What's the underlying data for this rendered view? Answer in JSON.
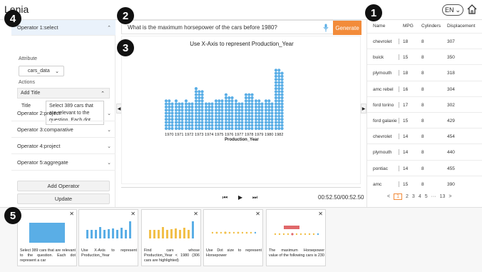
{
  "app": {
    "title": "Lenia"
  },
  "topbar": {
    "language": "EN",
    "home_icon": "home-icon"
  },
  "left_panel": {
    "operators": [
      {
        "label": "Operator 1:select"
      },
      {
        "label": "Operator 2:project"
      },
      {
        "label": "Operator 3:comparative"
      },
      {
        "label": "Operator 4:project"
      },
      {
        "label": "Operator 5:aggregate"
      }
    ],
    "attribute_label": "Attribute",
    "attribute_value": "cars_data",
    "actions_label": "Actions",
    "add_title_label": "Add Title",
    "title_label": "Title",
    "title_text": "Select 389 cars that are relevant to the question. Each dot represent a car",
    "add_operator_label": "Add Operator",
    "update_label": "Update"
  },
  "question": {
    "text": "What is the maximum horsepower of the cars before 1980?",
    "generate_label": "Generate"
  },
  "chart_data": {
    "type": "bar",
    "title": "Use X-Axis to represent Production_Year",
    "xlabel": "Production_Year",
    "ylabel": "",
    "categories": [
      "1970",
      "1971",
      "1972",
      "1973",
      "1974",
      "1975",
      "1976",
      "1977",
      "1978",
      "1979",
      "1980",
      "1982"
    ],
    "values": [
      29,
      28,
      28,
      40,
      27,
      30,
      34,
      28,
      36,
      29,
      29,
      59
    ],
    "color": "#5aaee6"
  },
  "player": {
    "time": "00:52.50/00:52.50"
  },
  "table": {
    "headers": [
      "Name",
      "MPG",
      "Cylinders",
      "Displacement"
    ],
    "rows": [
      [
        "chevrolet",
        "18",
        "8",
        "307"
      ],
      [
        "buick",
        "15",
        "8",
        "350"
      ],
      [
        "plymouth",
        "18",
        "8",
        "318"
      ],
      [
        "amc rebel",
        "16",
        "8",
        "304"
      ],
      [
        "ford torino",
        "17",
        "8",
        "302"
      ],
      [
        "ford galaxie",
        "15",
        "8",
        "429"
      ],
      [
        "chevrolet",
        "14",
        "8",
        "454"
      ],
      [
        "plymouth",
        "14",
        "8",
        "440"
      ],
      [
        "pontiac",
        "14",
        "8",
        "455"
      ],
      [
        "amc",
        "15",
        "8",
        "390"
      ]
    ],
    "pages": [
      "1",
      "2",
      "3",
      "4",
      "5",
      "···",
      "13"
    ],
    "prev": "<",
    "next": ">"
  },
  "cards": [
    {
      "text": "Select 389 cars that are relevant to the question. Each dot represent a car"
    },
    {
      "text": "Use X-Axis to represent Production_Year"
    },
    {
      "text": "Find cars whose Production_Year < 1980 (306 cars are highlighted)"
    },
    {
      "text": "Use Dot size to represent Horsepower"
    },
    {
      "text": "The maximum Horsepower value of the following cars is 230"
    }
  ],
  "badges": [
    "1",
    "2",
    "3",
    "4",
    "5"
  ],
  "colors": {
    "accent": "#f28b3a",
    "dot_blue": "#5aaee6",
    "dot_yellow": "#f2c04a"
  }
}
